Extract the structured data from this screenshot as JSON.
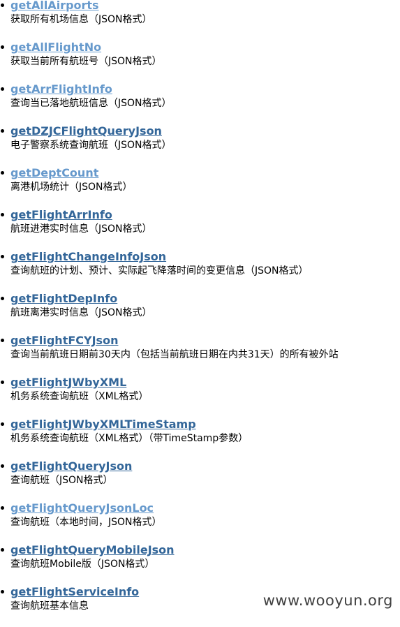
{
  "colors": {
    "link": "#336699",
    "link_visited": "#6699cc",
    "text": "#000000"
  },
  "operations": [
    {
      "name": "getAllAirports",
      "desc": "获取所有机场信息（JSON格式）",
      "visited": true
    },
    {
      "name": "getAllFlightNo",
      "desc": "获取当前所有航班号（JSON格式）",
      "visited": true
    },
    {
      "name": "getArrFlightInfo",
      "desc": "查询当已落地航班信息（JSON格式）",
      "visited": true
    },
    {
      "name": "getDZJCFlightQueryJson",
      "desc": "电子警察系统查询航班（JSON格式）",
      "visited": false
    },
    {
      "name": "getDeptCount",
      "desc": "离港机场统计（JSON格式）",
      "visited": true
    },
    {
      "name": "getFlightArrInfo",
      "desc": "航班进港实时信息（JSON格式）",
      "visited": false
    },
    {
      "name": "getFlightChangeInfoJson",
      "desc": "查询航班的计划、预计、实际起飞降落时间的变更信息（JSON格式）",
      "visited": false
    },
    {
      "name": "getFlightDepInfo",
      "desc": "航班离港实时信息（JSON格式）",
      "visited": false
    },
    {
      "name": "getFlightFCYJson",
      "desc": "查询当前航班日期前30天内（包括当前航班日期在内共31天）的所有被外站",
      "visited": false
    },
    {
      "name": "getFlightJWbyXML",
      "desc": "机务系统查询航班（XML格式）",
      "visited": false
    },
    {
      "name": "getFlightJWbyXMLTimeStamp",
      "desc": "机务系统查询航班（XML格式）（带TimeStamp参数）",
      "visited": false
    },
    {
      "name": "getFlightQueryJson",
      "desc": "查询航班（JSON格式）",
      "visited": false
    },
    {
      "name": "getFlightQueryJsonLoc",
      "desc": "查询航班（本地时间，JSON格式）",
      "visited": true
    },
    {
      "name": "getFlightQueryMobileJson",
      "desc": "查询航班Mobile版（JSON格式）",
      "visited": false
    },
    {
      "name": "getFlightServiceInfo",
      "desc": "查询航班基本信息",
      "visited": false
    }
  ],
  "watermark": "www.wooyun.org"
}
